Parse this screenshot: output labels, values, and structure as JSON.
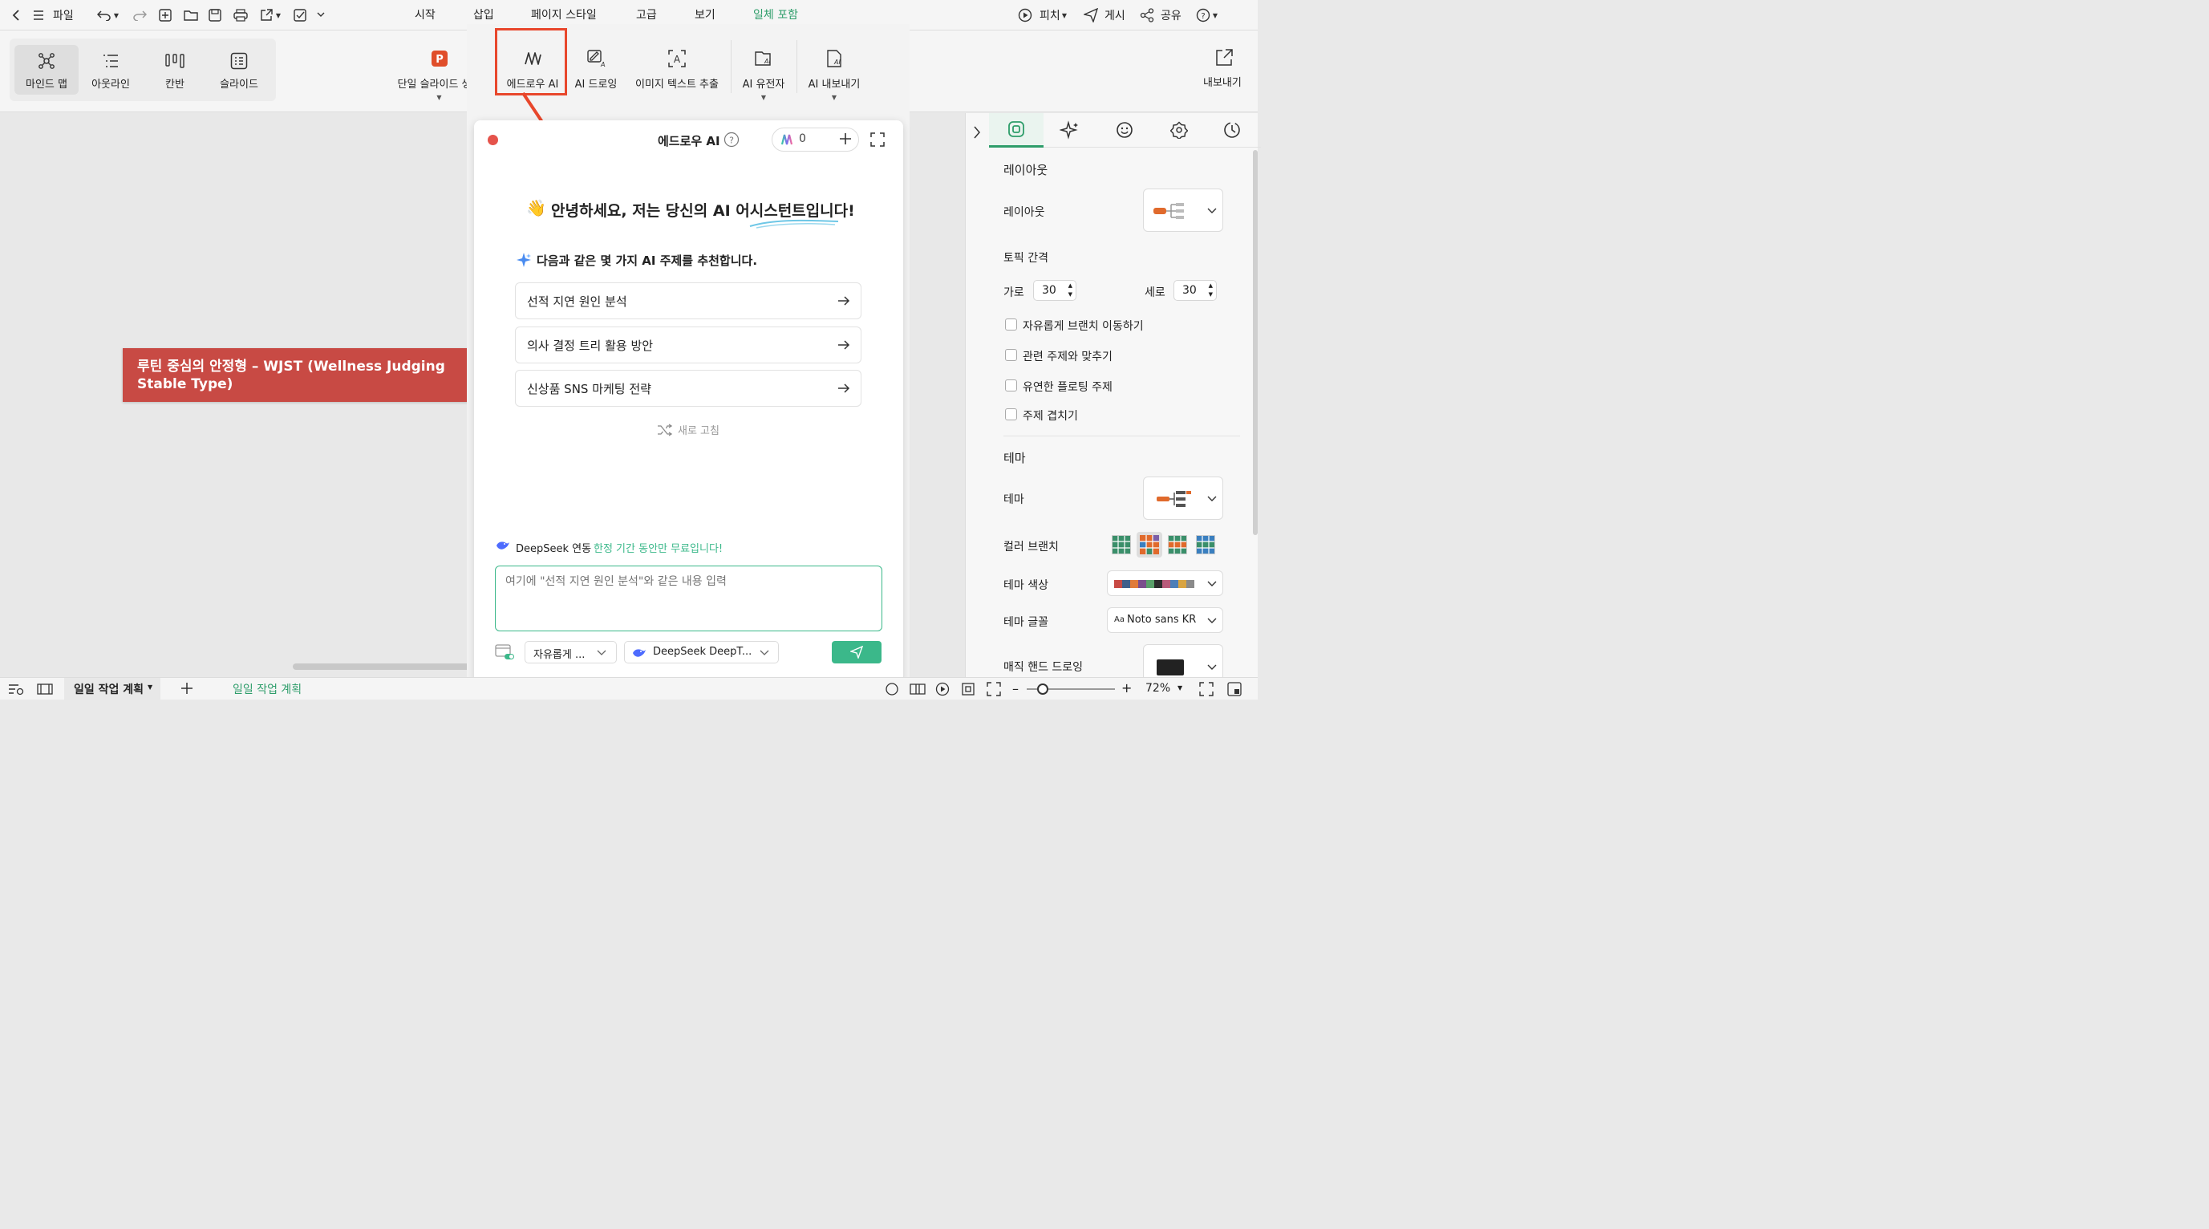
{
  "topbar": {
    "file_label": "파일",
    "menu_tabs": [
      "시작",
      "삽입",
      "페이지 스타일",
      "고급",
      "보기",
      "일체 포함"
    ],
    "active_tab": "일체 포함",
    "pitch_label": "피치",
    "publish_label": "게시",
    "share_label": "공유"
  },
  "ribbon": {
    "views": [
      "마인드 맵",
      "아웃라인",
      "칸반",
      "슬라이드"
    ],
    "active_view": "마인드 맵",
    "tools": [
      "단일 슬라이드 생성",
      "에드로우 AI",
      "AI 드로잉",
      "이미지 텍스트 추출",
      "AI 유전자",
      "AI 내보내기"
    ],
    "export_label": "내보내기"
  },
  "canvas": {
    "topic_text": "루틴 중심의 안정형 – WJST (Wellness Judging Stable Type)"
  },
  "ai_panel": {
    "title": "에드로우 AI",
    "credits": "0",
    "greeting": "안녕하세요, 저는 당신의 AI 어시스턴트입니다!",
    "greeting_emoji": "👋",
    "recommend_text": "다음과 같은 몇 가지 AI 주제를 추천합니다.",
    "suggestions": [
      "선적 지연 원인 분석",
      "의사 결정 트리 활용 방안",
      "신상품 SNS 마케팅 전략"
    ],
    "refresh_label": "새로 고침",
    "deepseek_label": "DeepSeek 연동",
    "promo_text": "한정 기간 동안만 무료입니다!",
    "input_placeholder": "여기에 \"선적 지연 원인 분석\"와 같은 내용 입력",
    "mode_select": "자유롭게 ...",
    "model_select": "DeepSeek DeepT..."
  },
  "right_panel": {
    "layout_header": "레이아웃",
    "layout_label": "레이아웃",
    "topic_spacing_label": "토픽 간격",
    "horizontal_label": "가로",
    "horizontal_value": "30",
    "vertical_label": "세로",
    "vertical_value": "30",
    "checkboxes": [
      "자유롭게 브랜치 이동하기",
      "관련 주제와 맞추기",
      "유연한 플로팅 주제",
      "주제 겹치기"
    ],
    "theme_header": "테마",
    "theme_label": "테마",
    "color_branch_label": "컬러 브랜치",
    "theme_color_label": "테마 색상",
    "theme_font_label": "테마 글꼴",
    "theme_font_value": "Noto sans KR",
    "theme_font_prefix": "Aa",
    "hand_drawing_label": "매직 핸드 드로잉",
    "theme_palette": [
      "#c84a44",
      "#3f5f8a",
      "#e07b39",
      "#7a4e8c",
      "#5aa06a",
      "#2c2c2c",
      "#b85a7a",
      "#4d7fb8",
      "#d9a441",
      "#8a8a8a"
    ]
  },
  "bottombar": {
    "sheet_name": "일일 작업 계획",
    "active_sheet": "일일 작업 계획",
    "zoom": "72%"
  },
  "colors": {
    "accent": "#2e9d6a",
    "topic": "#c84a44",
    "highlight_box": "#e8472c",
    "promo": "#3bb88a"
  }
}
